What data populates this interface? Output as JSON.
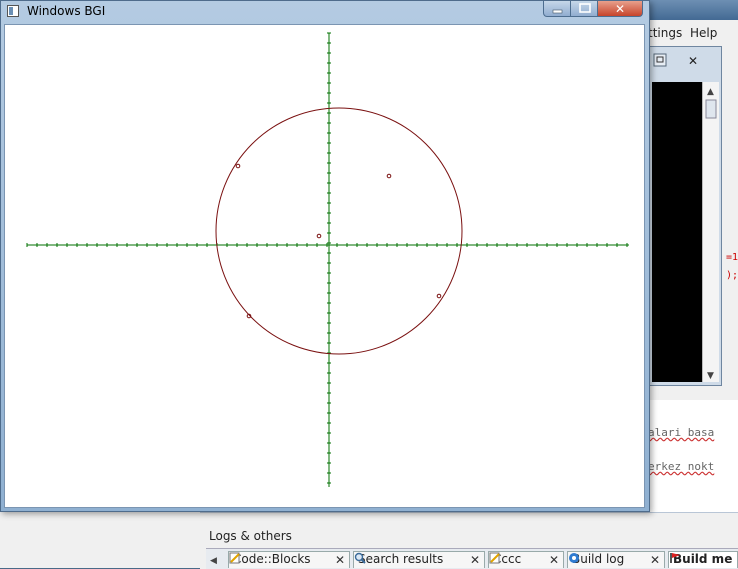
{
  "bgi_window": {
    "title": "Windows BGI"
  },
  "codeblocks": {
    "menu": {
      "settings_partial": "ttings",
      "help": "Help"
    },
    "editor_lines": [
      "alari basa",
      "erkez nokt"
    ]
  },
  "logs": {
    "title": "Logs & others",
    "tabs": [
      {
        "label": "Code::Blocks",
        "icon": "notepad-icon"
      },
      {
        "label": "Search results",
        "icon": "magnifier-icon"
      },
      {
        "label": "Cccc",
        "icon": "notepad-icon"
      },
      {
        "label": "Build log",
        "icon": "gear-icon"
      },
      {
        "label": "Build me",
        "icon": "flag-icon",
        "active": true
      }
    ]
  },
  "drawing": {
    "axis_color": "#007000",
    "circle_color": "#7a1010"
  }
}
